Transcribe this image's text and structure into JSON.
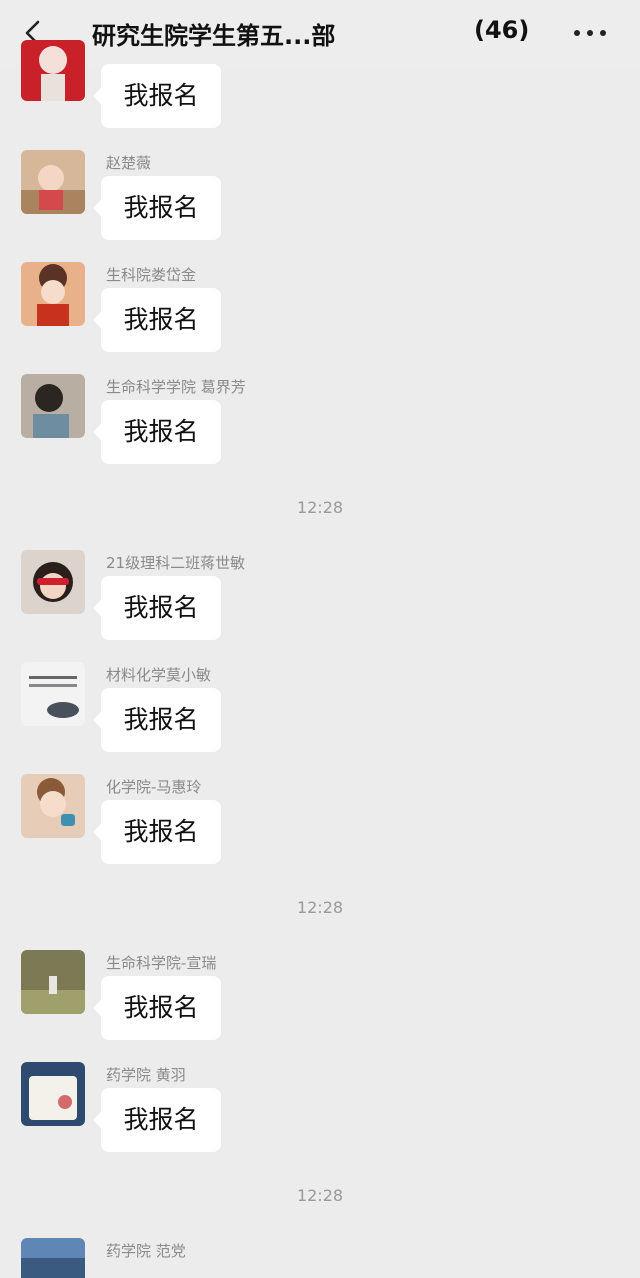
{
  "header": {
    "title": "研究生院学生第五...部",
    "member_count": "(46)",
    "back_icon": "chevron-left-icon",
    "more_icon": "more-dots-icon"
  },
  "messages": [
    {
      "sender": "",
      "text": "我报名"
    },
    {
      "sender": "赵楚薇",
      "text": "我报名"
    },
    {
      "sender": "生科院娄岱金",
      "text": "我报名"
    },
    {
      "sender": "生命科学学院 葛界芳",
      "text": "我报名"
    },
    {
      "sender": "21级理科二班蒋世敏",
      "text": "我报名"
    },
    {
      "sender": "材料化学莫小敏",
      "text": "我报名"
    },
    {
      "sender": "化学院-马惠玲",
      "text": "我报名"
    },
    {
      "sender": "生命科学院-宣瑞",
      "text": "我报名"
    },
    {
      "sender": "药学院 黄羽",
      "text": "我报名"
    },
    {
      "sender": "药学院 范党",
      "text": ""
    }
  ],
  "timestamps": [
    "12:28",
    "12:28",
    "12:28"
  ]
}
